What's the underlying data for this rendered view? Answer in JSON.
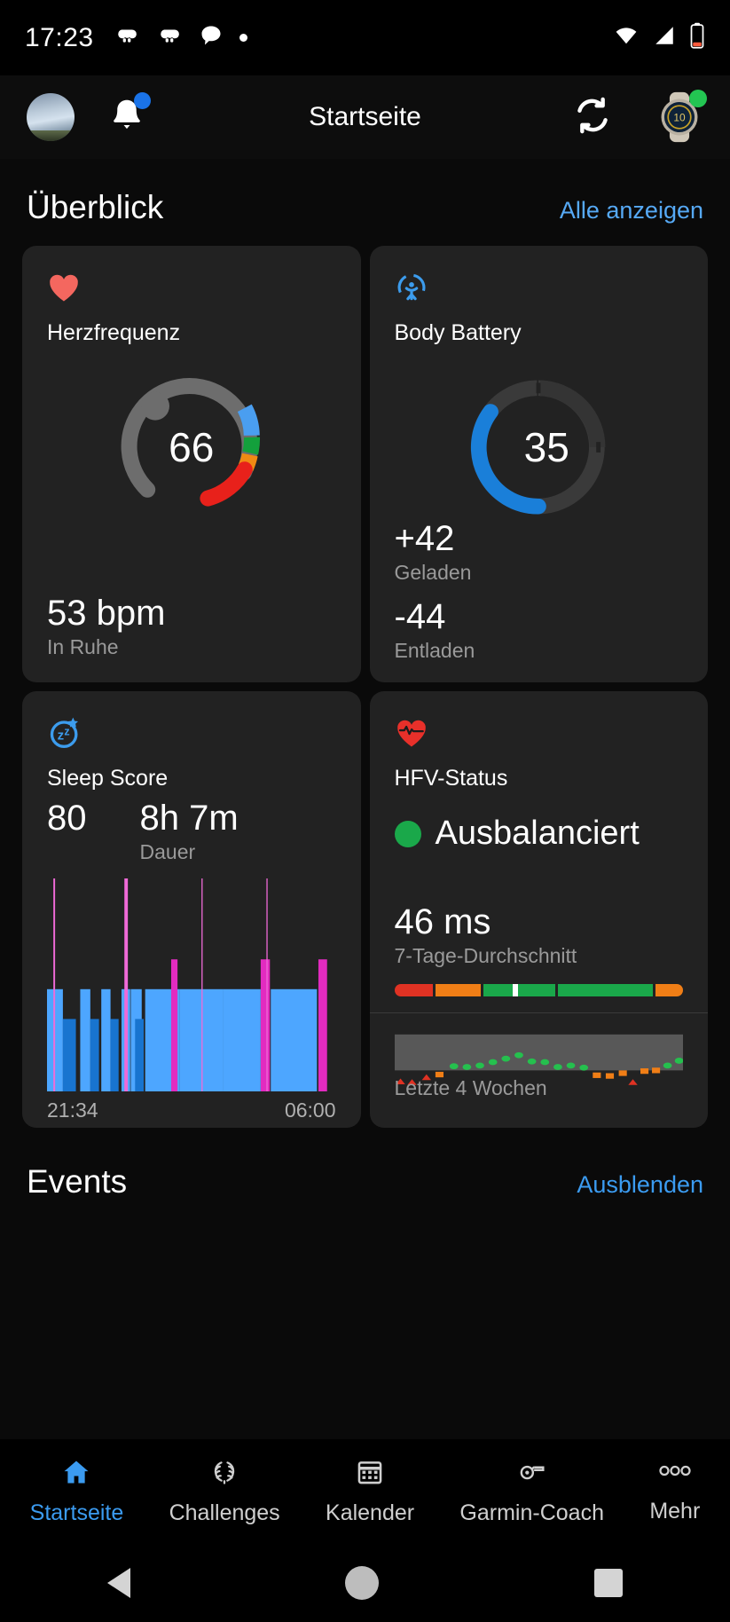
{
  "status_bar": {
    "time": "17:23",
    "left_icons": [
      "game-controller-icon",
      "game-controller-icon",
      "chat-bubble-icon",
      "dot-icon"
    ],
    "right_icons": [
      "wifi-icon",
      "cellular-signal-icon",
      "battery-low-icon"
    ]
  },
  "header": {
    "title": "Startseite",
    "avatar": "profile-avatar",
    "notifications_icon": "bell-icon",
    "sync_icon": "sync-icon",
    "device_icon": "watch-icon"
  },
  "overview": {
    "title": "Überblick",
    "view_all": "Alle anzeigen"
  },
  "cards": {
    "heart_rate": {
      "icon": "heart-icon",
      "title": "Herzfrequenz",
      "gauge_value": "66",
      "value": "53 bpm",
      "label": "In Ruhe"
    },
    "body_battery": {
      "icon": "body-battery-icon",
      "title": "Body Battery",
      "gauge_value": "35",
      "charged_value": "+42",
      "charged_label": "Geladen",
      "drained_value": "-44",
      "drained_label": "Entladen"
    },
    "sleep": {
      "icon": "sleep-icon",
      "title": "Sleep Score",
      "score": "80",
      "duration": "8h 7m",
      "duration_label": "Dauer",
      "start_time": "21:34",
      "end_time": "06:00"
    },
    "hrv": {
      "icon": "heart-pulse-icon",
      "title": "HFV-Status",
      "status": "Ausbalanciert",
      "status_color": "#1aa84a",
      "value": "46 ms",
      "value_label": "7-Tage-Durchschnitt",
      "range_label": "Letzte 4 Wochen"
    }
  },
  "events": {
    "title": "Events",
    "action": "Ausblenden"
  },
  "bottom_nav": {
    "items": [
      {
        "label": "Startseite",
        "icon": "home-icon",
        "active": true
      },
      {
        "label": "Challenges",
        "icon": "laurel-wreath-icon",
        "active": false
      },
      {
        "label": "Kalender",
        "icon": "calendar-icon",
        "active": false
      },
      {
        "label": "Garmin-Coach",
        "icon": "whistle-icon",
        "active": false
      },
      {
        "label": "Mehr",
        "icon": "more-dots-icon",
        "active": false
      }
    ]
  },
  "system_nav": {
    "back": "back-triangle-icon",
    "home": "home-circle-icon",
    "recents": "recents-square-icon"
  },
  "chart_data": [
    {
      "type": "bar",
      "name": "sleep-stages",
      "title": "Sleep stages",
      "xlabel": "",
      "ylabel": "",
      "x_ticks": [
        "21:34",
        "06:00"
      ],
      "colors": {
        "light": "#4da6ff",
        "deep": "#1874cf",
        "awake": "#e22bc0",
        "rem": "#f06ad8"
      },
      "series": [
        {
          "name": "stage",
          "values": [
            {
              "x": 0.0,
              "w": 0.055,
              "stage": "light",
              "h": 0.48
            },
            {
              "x": 0.022,
              "w": 0.006,
              "stage": "rem",
              "h": 1.0
            },
            {
              "x": 0.055,
              "w": 0.045,
              "stage": "deep",
              "h": 0.34
            },
            {
              "x": 0.115,
              "w": 0.035,
              "stage": "light",
              "h": 0.48
            },
            {
              "x": 0.15,
              "w": 0.03,
              "stage": "deep",
              "h": 0.34
            },
            {
              "x": 0.188,
              "w": 0.032,
              "stage": "light",
              "h": 0.48
            },
            {
              "x": 0.22,
              "w": 0.028,
              "stage": "deep",
              "h": 0.34
            },
            {
              "x": 0.258,
              "w": 0.03,
              "stage": "light",
              "h": 0.48
            },
            {
              "x": 0.268,
              "w": 0.012,
              "stage": "rem",
              "h": 1.0
            },
            {
              "x": 0.29,
              "w": 0.038,
              "stage": "light",
              "h": 0.48
            },
            {
              "x": 0.305,
              "w": 0.03,
              "stage": "deep",
              "h": 0.34
            },
            {
              "x": 0.34,
              "w": 0.12,
              "stage": "light",
              "h": 0.48
            },
            {
              "x": 0.43,
              "w": 0.022,
              "stage": "awake",
              "h": 0.62
            },
            {
              "x": 0.46,
              "w": 0.15,
              "stage": "light",
              "h": 0.48
            },
            {
              "x": 0.535,
              "w": 0.004,
              "stage": "rem",
              "h": 1.0
            },
            {
              "x": 0.61,
              "w": 0.13,
              "stage": "light",
              "h": 0.48
            },
            {
              "x": 0.74,
              "w": 0.032,
              "stage": "awake",
              "h": 0.62
            },
            {
              "x": 0.76,
              "w": 0.004,
              "stage": "rem",
              "h": 1.0
            },
            {
              "x": 0.775,
              "w": 0.16,
              "stage": "light",
              "h": 0.48
            },
            {
              "x": 0.94,
              "w": 0.03,
              "stage": "awake",
              "h": 0.62
            }
          ]
        }
      ]
    },
    {
      "type": "bar",
      "name": "hrv-range-bar",
      "title": "HRV range",
      "segments": [
        {
          "color": "#e03223",
          "w": 0.14
        },
        {
          "color": "#f07e16",
          "w": 0.16
        },
        {
          "color": "#1aa84a",
          "w": 0.26
        },
        {
          "color": "#1aa84a",
          "w": 0.34
        },
        {
          "color": "#f07e16",
          "w": 0.1
        }
      ],
      "marker_position": 0.41
    },
    {
      "type": "scatter",
      "name": "hrv-4-weeks",
      "title": "Letzte 4 Wochen",
      "xlabel": "",
      "ylabel": "",
      "band": {
        "color": "#585858",
        "top": 0.1,
        "bottom": 0.62
      },
      "series": [
        {
          "name": "status",
          "values": [
            {
              "x": 0.02,
              "y": 0.78,
              "status": "low",
              "marker": "triangle",
              "color": "#e03223"
            },
            {
              "x": 0.06,
              "y": 0.79,
              "status": "low",
              "marker": "triangle",
              "color": "#e03223"
            },
            {
              "x": 0.11,
              "y": 0.72,
              "status": "low",
              "marker": "triangle",
              "color": "#e03223"
            },
            {
              "x": 0.155,
              "y": 0.68,
              "status": "unbalanced",
              "marker": "square",
              "color": "#f07e16"
            },
            {
              "x": 0.205,
              "y": 0.56,
              "status": "balanced",
              "marker": "circle",
              "color": "#25c04e"
            },
            {
              "x": 0.25,
              "y": 0.57,
              "status": "balanced",
              "marker": "circle",
              "color": "#25c04e"
            },
            {
              "x": 0.295,
              "y": 0.55,
              "status": "balanced",
              "marker": "circle",
              "color": "#25c04e"
            },
            {
              "x": 0.34,
              "y": 0.5,
              "status": "balanced",
              "marker": "circle",
              "color": "#25c04e"
            },
            {
              "x": 0.385,
              "y": 0.45,
              "status": "balanced",
              "marker": "circle",
              "color": "#25c04e"
            },
            {
              "x": 0.43,
              "y": 0.4,
              "status": "balanced",
              "marker": "circle",
              "color": "#25c04e"
            },
            {
              "x": 0.475,
              "y": 0.49,
              "status": "balanced",
              "marker": "circle",
              "color": "#25c04e"
            },
            {
              "x": 0.52,
              "y": 0.5,
              "status": "balanced",
              "marker": "circle",
              "color": "#25c04e"
            },
            {
              "x": 0.565,
              "y": 0.57,
              "status": "balanced",
              "marker": "circle",
              "color": "#25c04e"
            },
            {
              "x": 0.61,
              "y": 0.55,
              "status": "balanced",
              "marker": "circle",
              "color": "#25c04e"
            },
            {
              "x": 0.655,
              "y": 0.58,
              "status": "balanced",
              "marker": "circle",
              "color": "#25c04e"
            },
            {
              "x": 0.7,
              "y": 0.69,
              "status": "unbalanced",
              "marker": "square",
              "color": "#f07e16"
            },
            {
              "x": 0.745,
              "y": 0.7,
              "status": "unbalanced",
              "marker": "square",
              "color": "#f07e16"
            },
            {
              "x": 0.79,
              "y": 0.66,
              "status": "unbalanced",
              "marker": "square",
              "color": "#f07e16"
            },
            {
              "x": 0.825,
              "y": 0.79,
              "status": "low",
              "marker": "triangle",
              "color": "#e03223"
            },
            {
              "x": 0.865,
              "y": 0.63,
              "status": "unbalanced",
              "marker": "square",
              "color": "#f07e16"
            },
            {
              "x": 0.905,
              "y": 0.62,
              "status": "unbalanced",
              "marker": "square",
              "color": "#f07e16"
            },
            {
              "x": 0.945,
              "y": 0.55,
              "status": "balanced",
              "marker": "circle",
              "color": "#25c04e"
            },
            {
              "x": 0.985,
              "y": 0.48,
              "status": "balanced",
              "marker": "circle",
              "color": "#25c04e"
            }
          ]
        }
      ]
    }
  ]
}
